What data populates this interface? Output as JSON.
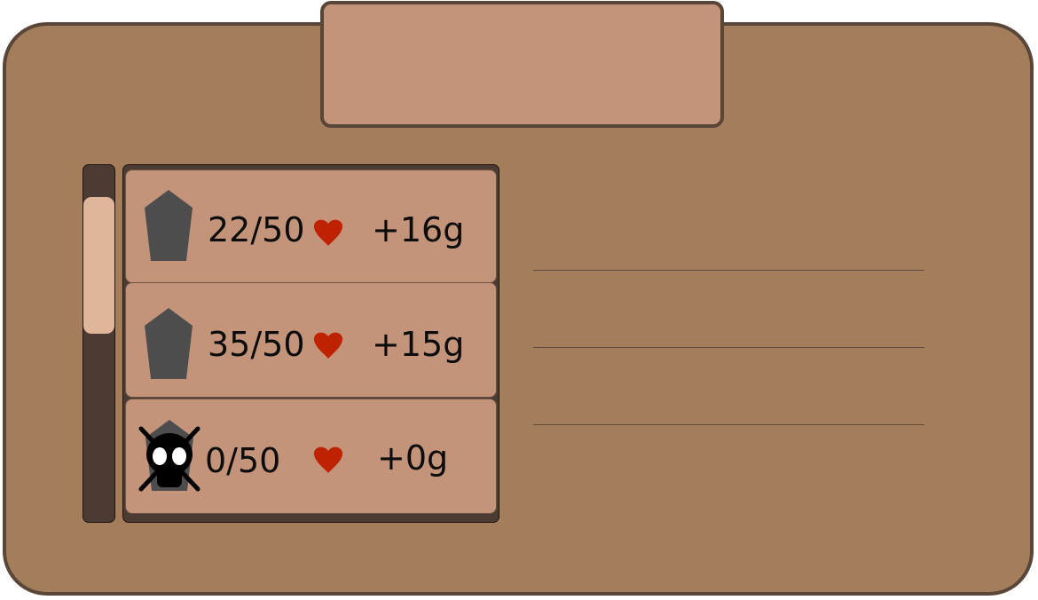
{
  "colors": {
    "board": "#a47e5a",
    "border": "#5a4639",
    "plate": "#c4947a",
    "frame": "#4c3b32",
    "thumb": "#e0b59b",
    "gem": "#4d4d4d",
    "heart": "#bf2200",
    "text": "#0c0c0c"
  },
  "list": {
    "scroll_position": 0.0,
    "items": [
      {
        "health": "22/50",
        "gold": "+16g",
        "icon": "pentagon-gem-icon",
        "dead": false
      },
      {
        "health": "35/50",
        "gold": "+15g",
        "icon": "pentagon-gem-icon",
        "dead": false
      },
      {
        "health": "0/50",
        "gold": "+0g",
        "icon": "pentagon-gem-icon",
        "dead": true,
        "overlay_icon": "crossed-skull-icon"
      }
    ]
  },
  "icons": {
    "heart": "heart-icon",
    "skull": "crossed-skull-icon",
    "gem": "pentagon-gem-icon"
  }
}
